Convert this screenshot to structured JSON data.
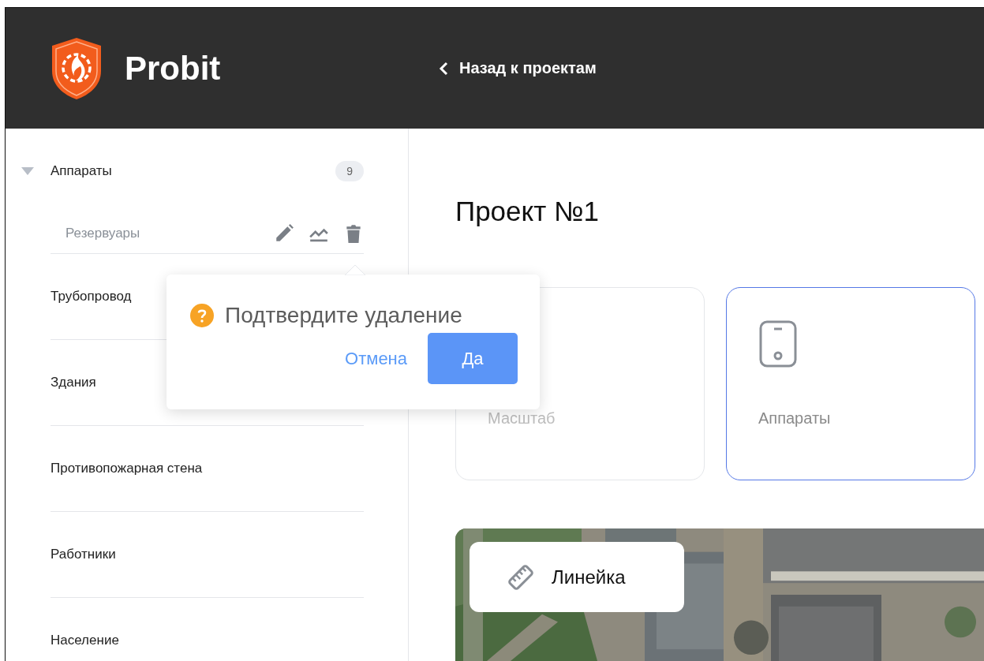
{
  "header": {
    "logo_text": "Probit",
    "back_link": "Назад к проектам"
  },
  "sidebar": {
    "items": [
      {
        "label": "Аппараты",
        "count": "9",
        "expanded": true,
        "children": [
          {
            "label": "Резервуары"
          }
        ]
      },
      {
        "label": "Трубопровод"
      },
      {
        "label": "Здания"
      },
      {
        "label": "Противопожарная стена"
      },
      {
        "label": "Работники"
      },
      {
        "label": "Население"
      }
    ]
  },
  "main": {
    "title": "Проект №1",
    "cards": [
      {
        "label": "Масштаб",
        "selected": false
      },
      {
        "label": "Аппараты",
        "selected": true
      }
    ],
    "map": {
      "kind": "picture",
      "tool_button": "Линейка"
    }
  },
  "popconfirm": {
    "message": "Подтвердите удаление",
    "cancel": "Отмена",
    "confirm": "Да"
  }
}
